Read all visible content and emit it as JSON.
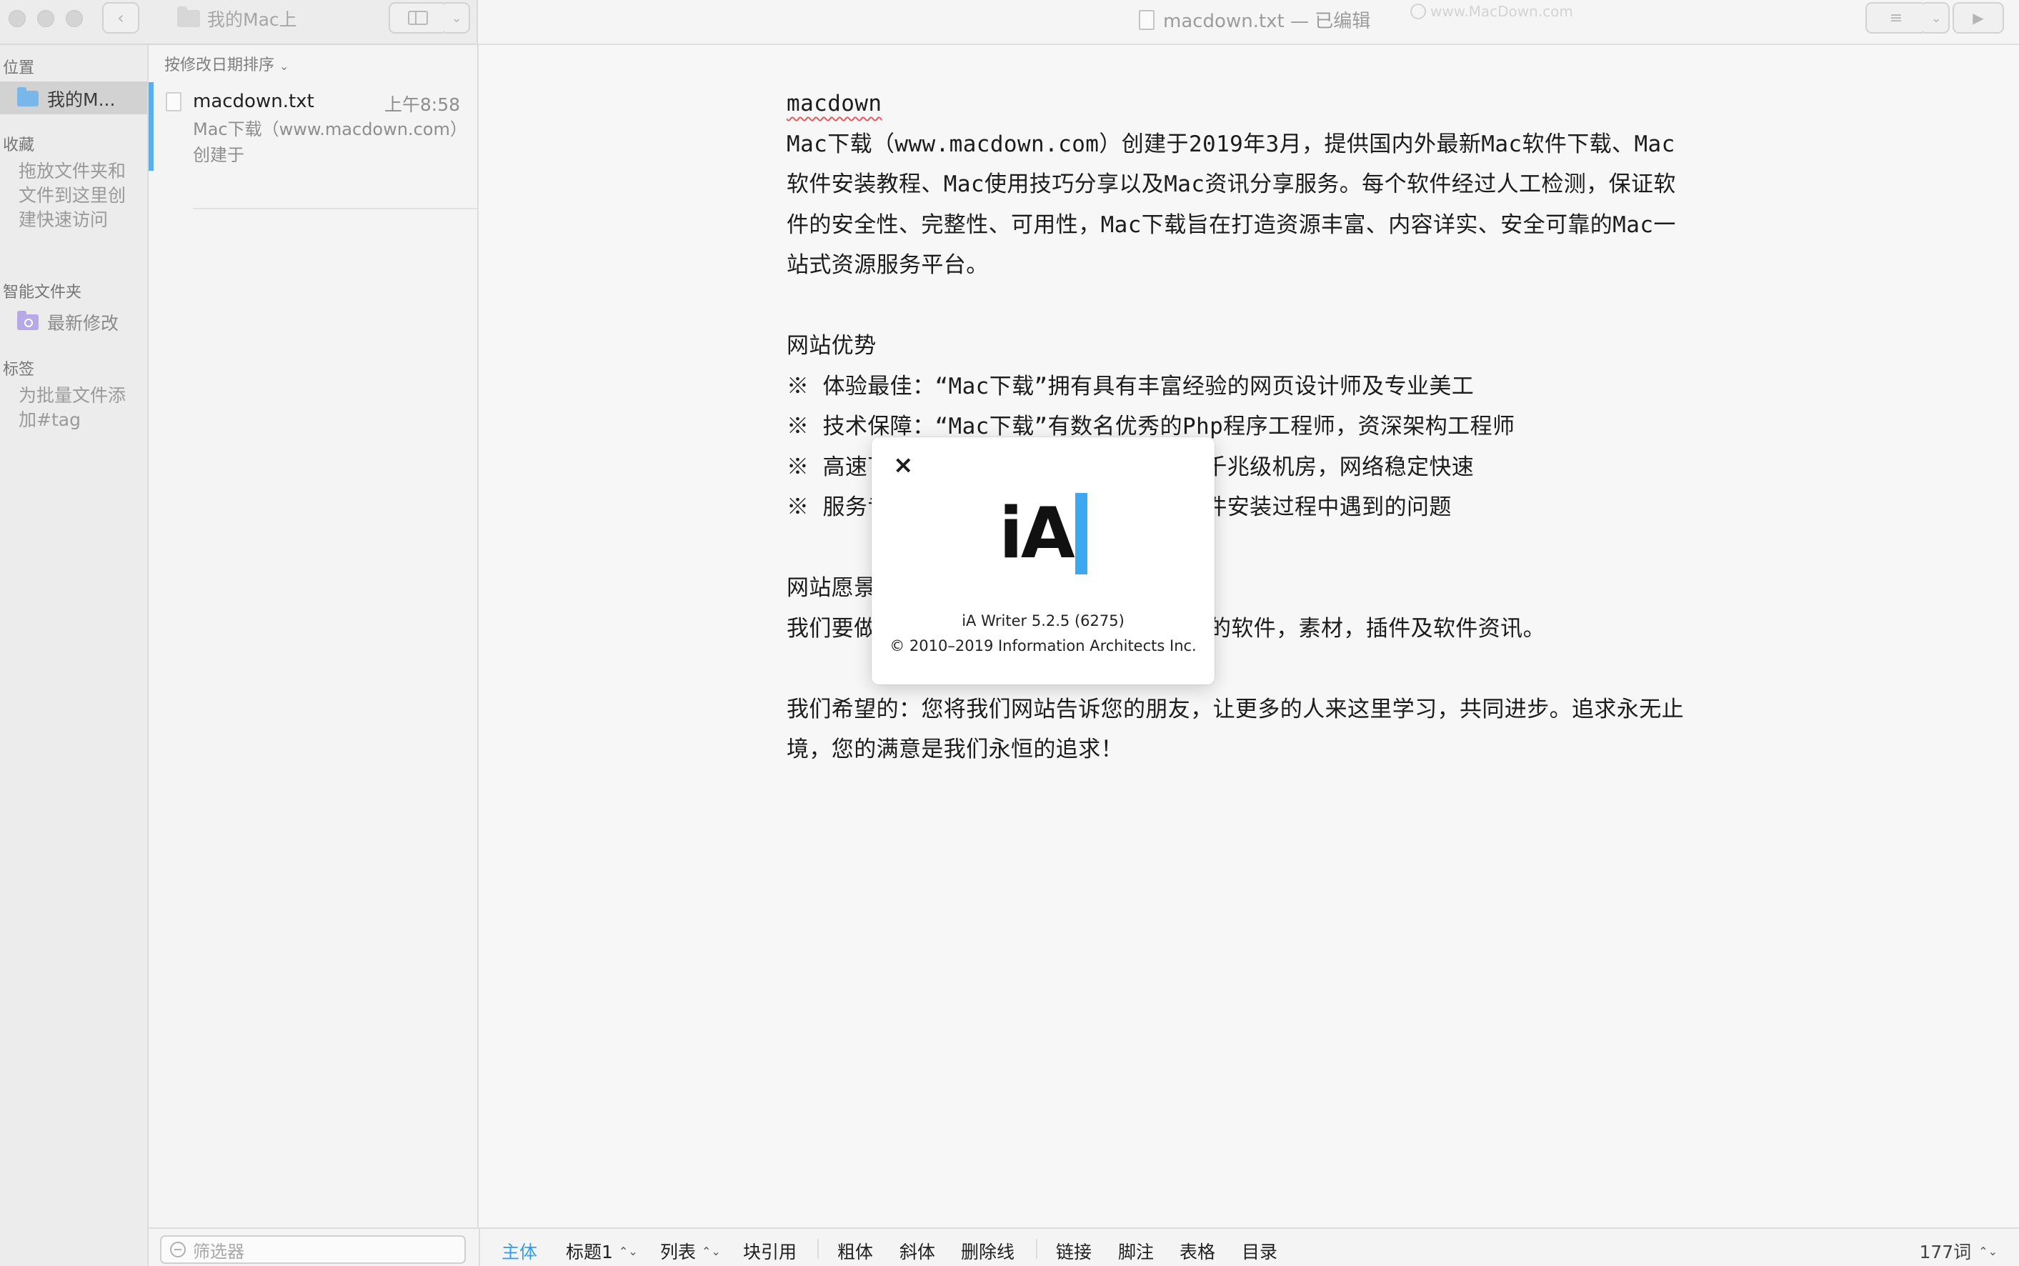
{
  "titlebar": {
    "folder_name": "我的Mac上",
    "window_title": "macdown.txt — 已编辑",
    "watermark": "www.MacDown.com",
    "icons": [
      "chevron-left-icon",
      "sidebar-toggle-icon",
      "chevron-down-icon",
      "outline-icon",
      "play-icon"
    ]
  },
  "sidebar": {
    "location_header": "位置",
    "location_item": "我的M...",
    "favorites_header": "收藏",
    "favorites_hint": "拖放文件夹和文件到这里创建快速访问",
    "smart_header": "智能文件夹",
    "smart_item": "最新修改",
    "tags_header": "标签",
    "tags_hint": "为批量文件添加#tag"
  },
  "filelist": {
    "sort_label": "按修改日期排序",
    "files": [
      {
        "name": "macdown.txt",
        "time": "上午8:58",
        "snippet": "Mac下载（www.macdown.com）创建于"
      }
    ]
  },
  "editor": {
    "lines": [
      "macdown",
      "Mac下载（www.macdown.com）创建于2019年3月，提供国内外最新Mac软件下载、Mac",
      "软件安装教程、Mac使用技巧分享以及Mac资讯分享服务。每个软件经过人工检测，保证软",
      "件的安全性、完整性、可用性，Mac下载旨在打造资源丰富、内容详实、安全可靠的Mac一",
      "站式资源服务平台。",
      "",
      "网站优势",
      "※  体验最佳：“Mac下载”拥有具有丰富经验的网页设计师及专业美工",
      "※  技术保障：“Mac下载”有数名优秀的Php程序工程师，资深架构工程师",
      "※  高速下载：“Mac下载”采用的服务器为千兆级机房，网络稳定快速",
      "※  服务专业：“Mac下载”会为用户解答软件安装过程中遇到的问题",
      "",
      "网站愿景",
      "我们要做一个提供Mac用户最全面、最完整的软件，素材，插件及软件资讯。",
      "",
      "我们希望的：您将我们网站告诉您的朋友，让更多的人来这里学习，共同进步。追求永无止",
      "境，您的满意是我们永恒的追求！"
    ]
  },
  "about": {
    "close": "×",
    "logo": "iA",
    "version": "iA Writer 5.2.5 (6275)",
    "copyright": "© 2010–2019 Information Architects Inc.",
    "cursor_color": "#3ea8ee"
  },
  "bottombar": {
    "filter_placeholder": "筛选器",
    "body": "主体",
    "heading": "标题1",
    "list": "列表",
    "blockquote": "块引用",
    "bold": "粗体",
    "italic": "斜体",
    "strike": "删除线",
    "link": "链接",
    "footnote": "脚注",
    "table": "表格",
    "toc": "目录",
    "word_count": "177词",
    "updown": "⌃⌄",
    "accent_color": "#3a9ee6"
  }
}
